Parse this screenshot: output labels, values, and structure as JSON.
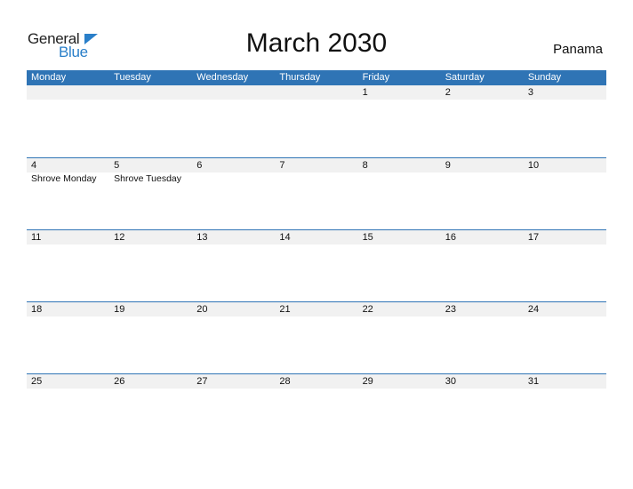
{
  "logo": {
    "word1": "General",
    "word2": "Blue"
  },
  "title": "March 2030",
  "country": "Panama",
  "colors": {
    "header_bg": "#2f74b5",
    "date_row_bg": "#f1f1f1",
    "logo_blue": "#2a7fc9"
  },
  "weekdays": [
    "Monday",
    "Tuesday",
    "Wednesday",
    "Thursday",
    "Friday",
    "Saturday",
    "Sunday"
  ],
  "weeks": [
    {
      "dates": [
        "",
        "",
        "",
        "",
        "1",
        "2",
        "3"
      ],
      "events": [
        "",
        "",
        "",
        "",
        "",
        "",
        ""
      ]
    },
    {
      "dates": [
        "4",
        "5",
        "6",
        "7",
        "8",
        "9",
        "10"
      ],
      "events": [
        "Shrove Monday",
        "Shrove Tuesday",
        "",
        "",
        "",
        "",
        ""
      ]
    },
    {
      "dates": [
        "11",
        "12",
        "13",
        "14",
        "15",
        "16",
        "17"
      ],
      "events": [
        "",
        "",
        "",
        "",
        "",
        "",
        ""
      ]
    },
    {
      "dates": [
        "18",
        "19",
        "20",
        "21",
        "22",
        "23",
        "24"
      ],
      "events": [
        "",
        "",
        "",
        "",
        "",
        "",
        ""
      ]
    },
    {
      "dates": [
        "25",
        "26",
        "27",
        "28",
        "29",
        "30",
        "31"
      ],
      "events": [
        "",
        "",
        "",
        "",
        "",
        "",
        ""
      ]
    }
  ]
}
